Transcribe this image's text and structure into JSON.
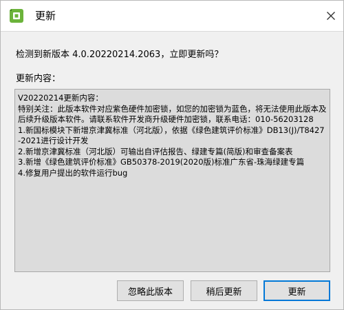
{
  "window": {
    "title": "更新",
    "icon": "app-green-cube-icon"
  },
  "prompt": "检测到新版本 4.0.20220214.2063，立即更新吗？",
  "content_label": "更新内容：",
  "notes": [
    "V20220214更新内容：",
    "特别关注：此版本软件对应紫色硬件加密锁，如您的加密锁为蓝色，将无法使用此版本及后续升级版本软件。请联系软件开发商升级硬件加密锁，联系电话：010-56203128",
    "1.新国标模块下新增京津冀标准（河北版），依据《绿色建筑评价标准》DB13(J)/T8427-2021进行设计开发",
    "2.新增京津冀标准（河北版）可输出自评估报告、绿建专篇(简版)和审查备案表",
    "3.新增《绿色建筑评价标准》GB50378-2019(2020版)标准广东省-珠海绿建专篇",
    "4.修复用户提出的软件运行bug"
  ],
  "buttons": {
    "skip": "忽略此版本",
    "later": "稍后更新",
    "update": "更新"
  },
  "colors": {
    "accent": "#0078d7",
    "icon_green": "#5aa02c"
  }
}
